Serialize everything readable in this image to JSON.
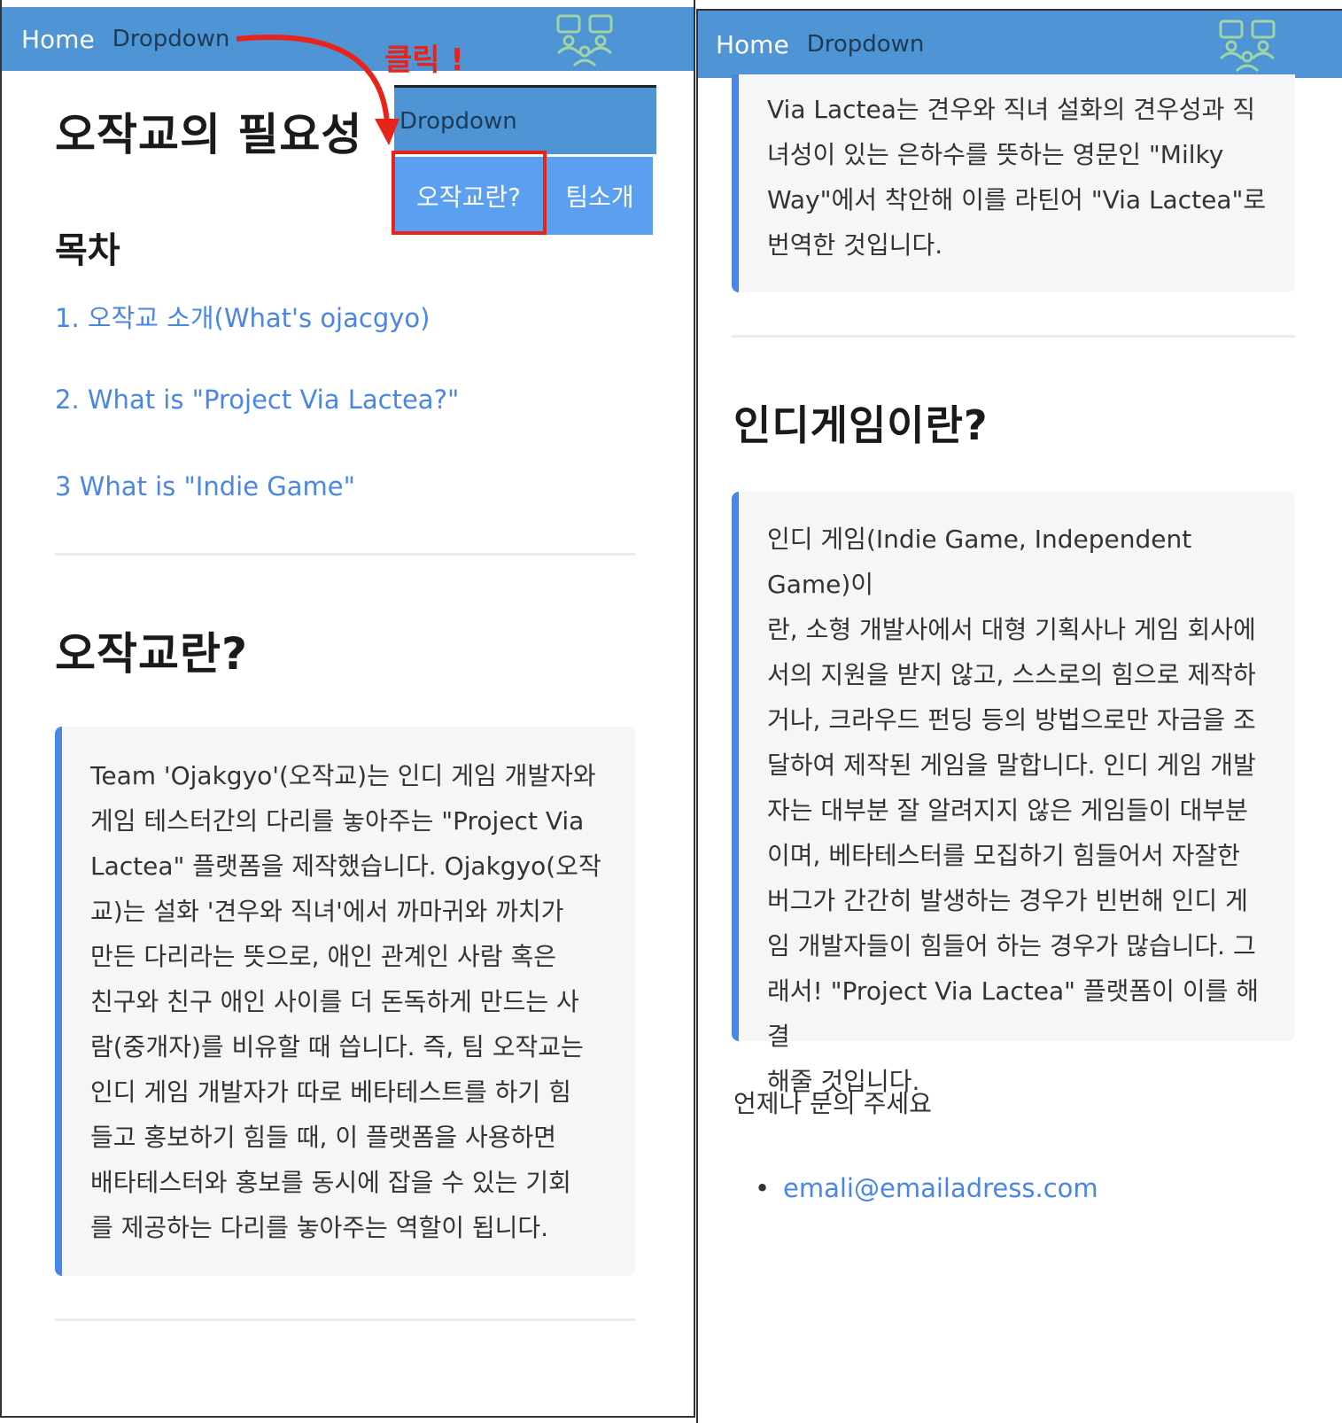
{
  "nav": {
    "home": "Home",
    "dropdown": "Dropdown"
  },
  "dropdown": {
    "header": "Dropdown",
    "item1": "오작교란?",
    "item2": "팀소개"
  },
  "annotation": {
    "click": "클릭 !"
  },
  "left": {
    "title": "오작교의 필요성",
    "toc_heading": "목차",
    "toc": [
      "1. 오작교 소개(What's ojacgyo)",
      "2. What is \"Project Via Lactea?\"",
      "3 What is \"Indie Game\""
    ],
    "section_title": "오작교란?",
    "callout_lines": [
      "Team 'Ojakgyo'(오작교)는 인디 게임 개발자와",
      "게임 테스터간의 다리를 놓아주는 \"Project Via",
      "Lactea\" 플랫폼을 제작했습니다. Ojakgyo(오작",
      "교)는 설화 '견우와 직녀'에서 까마귀와 까치가",
      "만든 다리라는 뜻으로, 애인 관계인 사람 혹은",
      "친구와 친구 애인 사이를 더 돈독하게 만드는 사",
      "람(중개자)를 비유할 때 씁니다. 즉, 팀 오작교는",
      "인디 게임 개발자가 따로 베타테스트를 하기 힘",
      "들고 홍보하기 힘들 때, 이 플랫폼을 사용하면",
      "배타테스터와 홍보를 동시에 잡을 수 있는 기회",
      "를 제공하는 다리를 놓아주는 역할이 됩니다."
    ]
  },
  "right": {
    "via_lines": [
      "Via Lactea는 견우와 직녀 설화의 견우성과 직",
      "녀성이 있는 은하수를 뜻하는 영문인 \"Milky",
      "Way\"에서 착안해 이를 라틴어 \"Via Lactea\"로",
      "번역한 것입니다."
    ],
    "indie_title": "인디게임이란?",
    "indie_lines": [
      "인디 게임(Indie Game, Independent Game)이",
      "란, 소형 개발사에서 대형 기획사나 게임 회사에",
      "서의 지원을 받지 않고, 스스로의 힘으로 제작하",
      "거나, 크라우드 펀딩 등의 방법으로만 자금을 조",
      "달하여 제작된 게임을 말합니다. 인디 게임 개발",
      "자는 대부분 잘 알려지지 않은 게임들이 대부분",
      "이며, 베타테스터를 모집하기 힘들어서 자잘한",
      "버그가 간간히 발생하는 경우가 빈번해 인디 게",
      "임 개발자들이 힘들어 하는 경우가 많습니다. 그",
      "래서! \"Project Via Lactea\" 플랫폼이 이를 해결",
      "해줄 것입니다."
    ],
    "contact": "언제나 문의 주세요",
    "email": "emali@emailadress.com",
    "bullet": "•"
  },
  "colors": {
    "navbar": "#4f94d4",
    "link": "#4a86e8",
    "highlight": "#e8231a",
    "logo": "#9fd5a6"
  },
  "icons": {
    "logo": "team-people-icon",
    "arrow": "curved-arrow-icon"
  }
}
